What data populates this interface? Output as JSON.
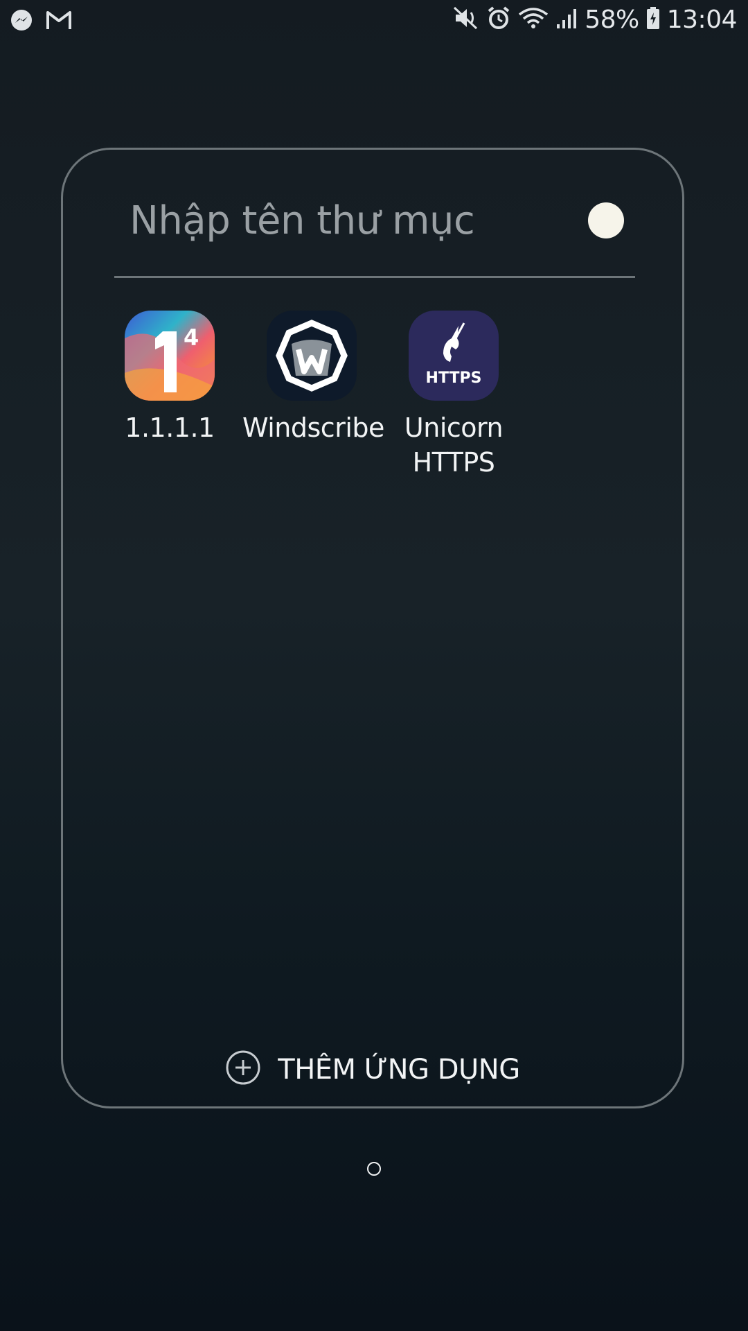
{
  "status_bar": {
    "notification_icons": [
      "messenger-icon",
      "gmail-icon"
    ],
    "system_icons": [
      "mute-icon",
      "alarm-icon",
      "wifi-icon",
      "signal-icon",
      "battery-icon"
    ],
    "battery_percent": "58%",
    "time": "13:04"
  },
  "folder": {
    "name_placeholder": "Nhập tên thư mục",
    "color_swatch": "#f6f4ea",
    "apps": [
      {
        "label": "1.1.1.1",
        "icon": "cloudflare-1111-icon"
      },
      {
        "label": "Windscribe",
        "icon": "windscribe-icon"
      },
      {
        "label": "Unicorn HTTPS",
        "icon": "unicorn-https-icon",
        "icon_text": "HTTPS"
      }
    ],
    "add_apps_label": "THÊM ỨNG DỤNG"
  },
  "colors": {
    "background": "#141b21",
    "folder_border": "#6d7579",
    "text_primary": "#f2f4f5",
    "placeholder": "#9aa0a4"
  }
}
